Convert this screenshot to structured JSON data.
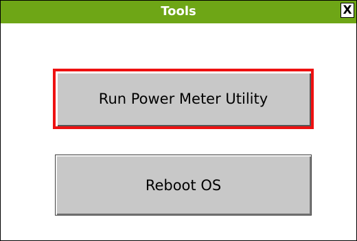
{
  "window": {
    "title": "Tools",
    "close_label": "X"
  },
  "buttons": {
    "run_power_meter": "Run Power Meter Utility",
    "reboot": "Reboot OS"
  },
  "colors": {
    "titlebar": "#6ea616",
    "focus_border": "#ee1111",
    "button_face": "#c8c8c8"
  }
}
